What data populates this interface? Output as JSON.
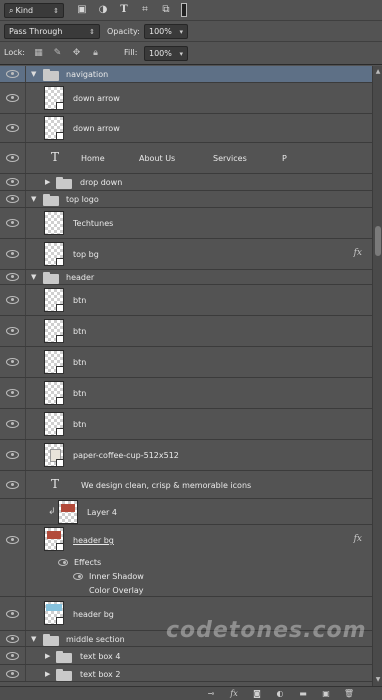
{
  "toolbar": {
    "filter_label": "Kind",
    "blend_mode": "Pass Through",
    "opacity_label": "Opacity:",
    "opacity_value": "100%",
    "lock_label": "Lock:",
    "fill_label": "Fill:",
    "fill_value": "100%"
  },
  "layers": {
    "navigation": "navigation",
    "down_arrow_1": "down arrow",
    "down_arrow_2": "down arrow",
    "nav_text": {
      "home": "Home",
      "about": "About Us",
      "services": "Services",
      "p": "P"
    },
    "drop_down": "drop down",
    "top_logo": "top logo",
    "techtunes": "Techtunes",
    "top_bg": "top bg",
    "header": "header",
    "btn_1": "btn",
    "btn_2": "btn",
    "btn_3": "btn",
    "btn_4": "btn",
    "btn_5": "btn",
    "paper_cup": "paper-coffee-cup-512x512",
    "tagline": "We design clean, crisp & memorable icons",
    "layer4": "Layer 4",
    "header_bg_1": "header bg",
    "effects": "Effects",
    "inner_shadow": "Inner Shadow",
    "color_overlay": "Color Overlay",
    "header_bg_2": "header bg",
    "middle_section": "middle section",
    "text_box_4": "text box 4",
    "text_box_2": "text box 2"
  },
  "fx_label": "fx",
  "watermark": "codetones.com"
}
